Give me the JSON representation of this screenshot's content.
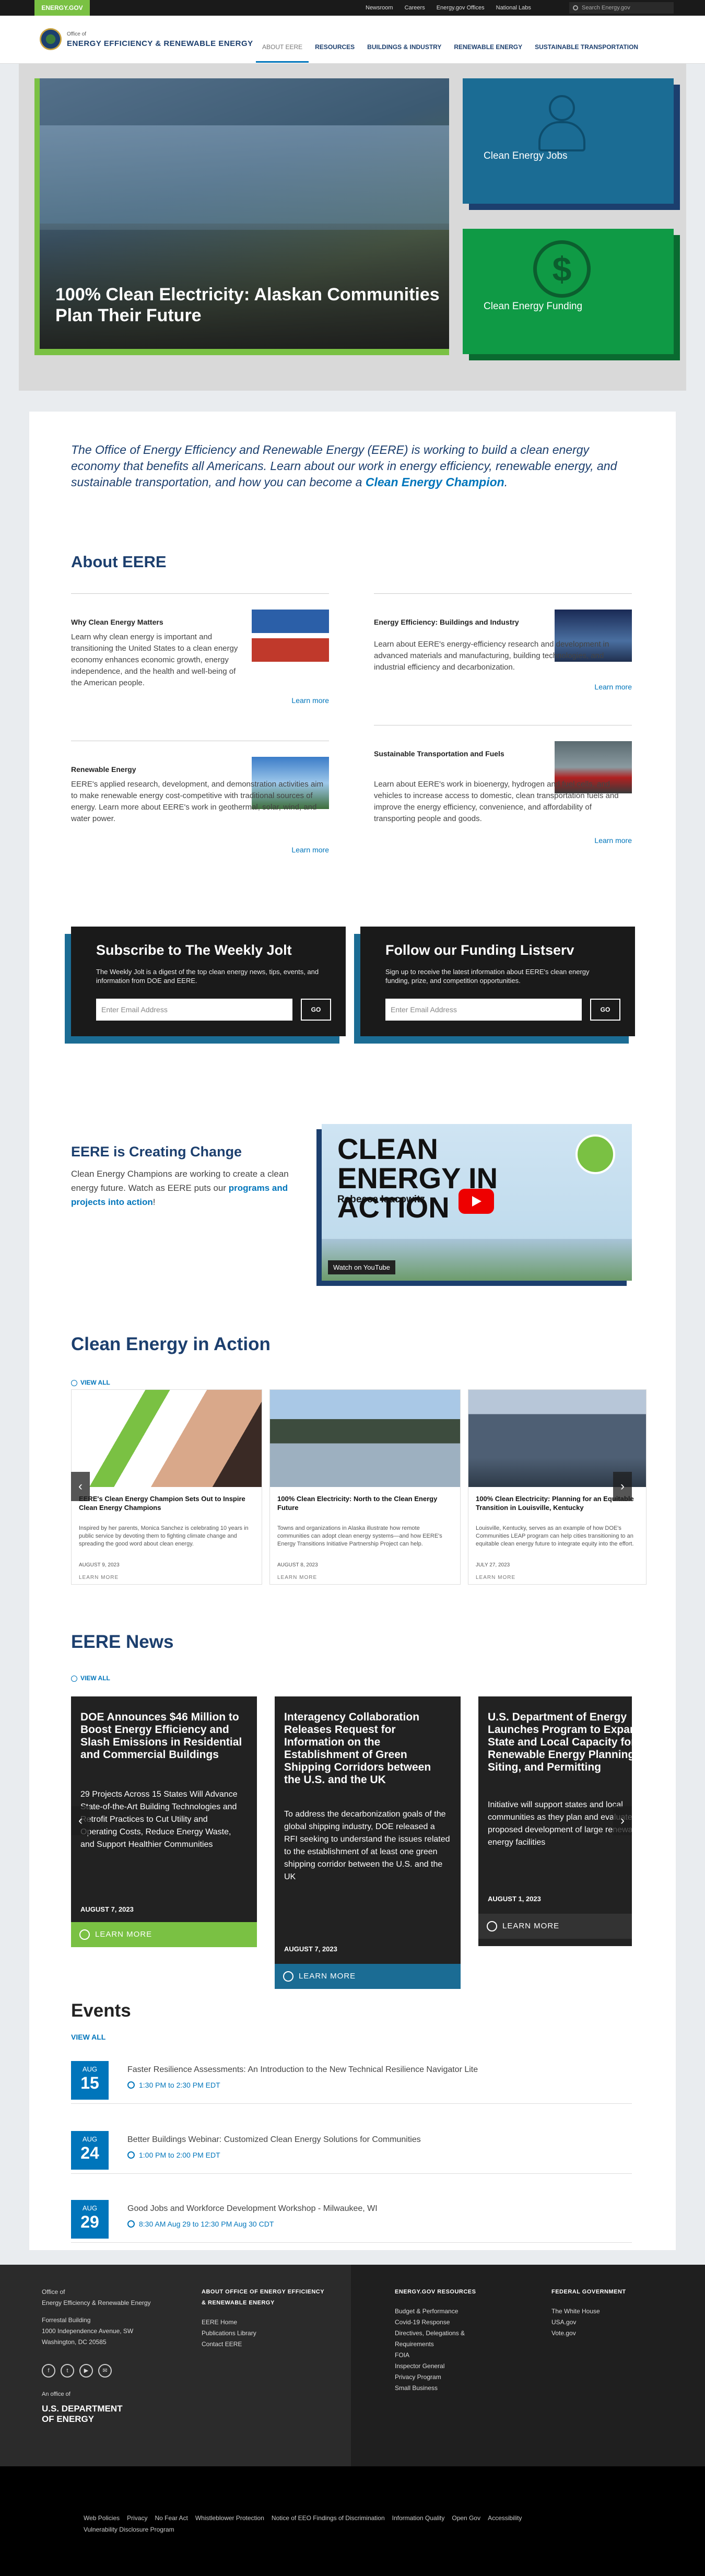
{
  "topbar": {
    "brand": "ENERGY.GOV",
    "links": [
      "Newsroom",
      "Careers",
      "Energy.gov Offices",
      "National Labs"
    ],
    "search_placeholder": "Search Energy.gov"
  },
  "header": {
    "office": "Office of",
    "name": "ENERGY EFFICIENCY & RENEWABLE ENERGY",
    "nav": [
      "ABOUT EERE",
      "RESOURCES",
      "BUILDINGS & INDUSTRY",
      "RENEWABLE ENERGY",
      "SUSTAINABLE TRANSPORTATION"
    ]
  },
  "hero": {
    "main_title": "100% Clean Electricity: Alaskan Communities Plan Their Future",
    "tile1": "Clean Energy Jobs",
    "tile2": "Clean Energy Funding"
  },
  "intro": {
    "text": "The Office of Energy Efficiency and Renewable Energy (EERE) is working to build a clean energy economy that benefits all Americans. Learn about our work in energy efficiency, renewable energy, and sustainable transportation, and how you can become a ",
    "link": "Clean Energy Champion",
    "end": "."
  },
  "about": {
    "heading": "About EERE",
    "cards": [
      {
        "title": "Why Clean Energy Matters",
        "text": "Learn why clean energy is important and transitioning the United States to a clean energy economy enhances economic growth, energy independence, and the health and well-being of the American people.",
        "more": "Learn more"
      },
      {
        "title": "Energy Efficiency: Buildings and Industry",
        "text": "Learn about EERE's energy-efficiency research and development in advanced materials and manufacturing, building technologies, and industrial efficiency and decarbonization.",
        "more": "Learn more"
      },
      {
        "title": "Renewable Energy",
        "text": "EERE's applied research, development, and demonstration activities aim to make renewable energy cost-competitive with traditional sources of energy. Learn more about EERE's work in geothermal, solar, wind, and water power.",
        "more": "Learn more"
      },
      {
        "title": "Sustainable Transportation and Fuels",
        "text": "Learn about EERE's work in bioenergy, hydrogen and fuel cells, and vehicles to increase access to domestic, clean transportation fuels and improve the energy efficiency, convenience, and affordability of transporting people and goods.",
        "more": "Learn more"
      }
    ]
  },
  "subscribe": [
    {
      "title": "Subscribe to The Weekly Jolt",
      "text": "The Weekly Jolt is a digest of the top clean energy news, tips, events, and information from DOE and EERE.",
      "placeholder": "Enter Email Address",
      "button": "GO"
    },
    {
      "title": "Follow our Funding Listserv",
      "text": "Sign up to receive the latest information about EERE's clean energy funding, prize, and competition opportunities.",
      "placeholder": "Enter Email Address",
      "button": "GO"
    }
  ],
  "change": {
    "heading": "EERE is Creating Change",
    "text": "Clean Energy Champions are working to create a clean energy future. Watch as EERE puts our ",
    "link": "programs and projects into action",
    "end": "!",
    "video_title": "CLEAN ENERGY IN ACTION",
    "video_name": "Rebecca Isacowitz",
    "video_watch": "Watch on  YouTube"
  },
  "cea": {
    "heading": "Clean Energy in Action",
    "view_all": "VIEW ALL",
    "items": [
      {
        "title": "EERE's Clean Energy Champion Sets Out to Inspire Clean Energy Champions",
        "text": "Inspired by her parents, Monica Sanchez is celebrating 10 years in public service by devoting them to fighting climate change and spreading the good word about clean energy.",
        "date": "AUGUST 9, 2023",
        "more": "LEARN MORE"
      },
      {
        "title": "100% Clean Electricity: North to the Clean Energy Future",
        "text": "Towns and organizations in Alaska illustrate how remote communities can adopt clean energy systems—and how EERE's Energy Transitions Initiative Partnership Project can help.",
        "date": "AUGUST 8, 2023",
        "more": "LEARN MORE"
      },
      {
        "title": "100% Clean Electricity: Planning for an Equitable Transition in Louisville, Kentucky",
        "text": "Louisville, Kentucky, serves as an example of how DOE's Communities LEAP program can help cities transitioning to an equitable clean energy future to integrate equity into the effort.",
        "date": "JULY 27, 2023",
        "more": "LEARN MORE"
      }
    ]
  },
  "news": {
    "heading": "EERE News",
    "view_all": "VIEW ALL",
    "items": [
      {
        "title": "DOE Announces $46 Million to Boost Energy Efficiency and Slash Emissions in Residential and Commercial Buildings",
        "text": "29 Projects Across 15 States Will Advance State-of-the-Art Building Technologies and Retrofit Practices to Cut Utility and Operating Costs, Reduce Energy Waste, and Support Healthier Communities",
        "date": "AUGUST 7, 2023",
        "more": "LEARN MORE"
      },
      {
        "title": "Interagency Collaboration Releases Request for Information on the Establishment of Green Shipping Corridors between the U.S. and the UK",
        "text": "To address the decarbonization goals of the global shipping industry, DOE released a RFI seeking to understand the issues related to the establishment of at least one green shipping corridor between the U.S. and the UK",
        "date": "AUGUST 7, 2023",
        "more": "LEARN MORE"
      },
      {
        "title": "U.S. Department of Energy Launches Program to Expand State and Local Capacity for Renewable Energy Planning, Siting, and Permitting",
        "text": "Initiative will support states and local communities as they plan and evaluate proposed development of large renewable energy facilities",
        "date": "AUGUST 1, 2023",
        "more": "LEARN MORE"
      }
    ]
  },
  "events": {
    "heading": "Events",
    "view_all": "VIEW ALL",
    "items": [
      {
        "month": "AUG",
        "day": "15",
        "title": "Faster Resilience Assessments: An Introduction to the New Technical Resilience Navigator Lite",
        "time": "1:30 PM to 2:30 PM EDT"
      },
      {
        "month": "AUG",
        "day": "24",
        "title": "Better Buildings Webinar: Customized Clean Energy Solutions for Communities",
        "time": "1:00 PM to 2:00 PM EDT"
      },
      {
        "month": "AUG",
        "day": "29",
        "title": "Good Jobs and Workforce Development Workshop - Milwaukee, WI",
        "time": "8:30 AM Aug 29 to 12:30 PM Aug 30 CDT"
      }
    ]
  },
  "footer": {
    "office": [
      "Office of",
      "Energy Efficiency & Renewable Energy"
    ],
    "address": [
      "Forrestal Building",
      "1000 Independence Avenue, SW",
      "Washington, DC 20585"
    ],
    "an_office_of": "An office of",
    "doe": "U.S. DEPARTMENT OF ENERGY",
    "col1": {
      "title": "ABOUT OFFICE OF ENERGY EFFICIENCY & RENEWABLE ENERGY",
      "links": [
        "EERE Home",
        "Publications Library",
        "Contact EERE"
      ]
    },
    "col2": {
      "title": "ENERGY.GOV RESOURCES",
      "links": [
        "Budget & Performance",
        "Covid-19 Response",
        "Directives, Delegations & Requirements",
        "FOIA",
        "Inspector General",
        "Privacy Program",
        "Small Business"
      ]
    },
    "col3": {
      "title": "FEDERAL GOVERNMENT",
      "links": [
        "The White House",
        "USA.gov",
        "Vote.gov"
      ]
    }
  },
  "bottom_links": [
    "Web Policies",
    "Privacy",
    "No Fear Act",
    "Whistleblower Protection",
    "Notice of EEO Findings of Discrimination",
    "Information Quality",
    "Open Gov",
    "Accessibility",
    "Vulnerability Disclosure Program"
  ]
}
